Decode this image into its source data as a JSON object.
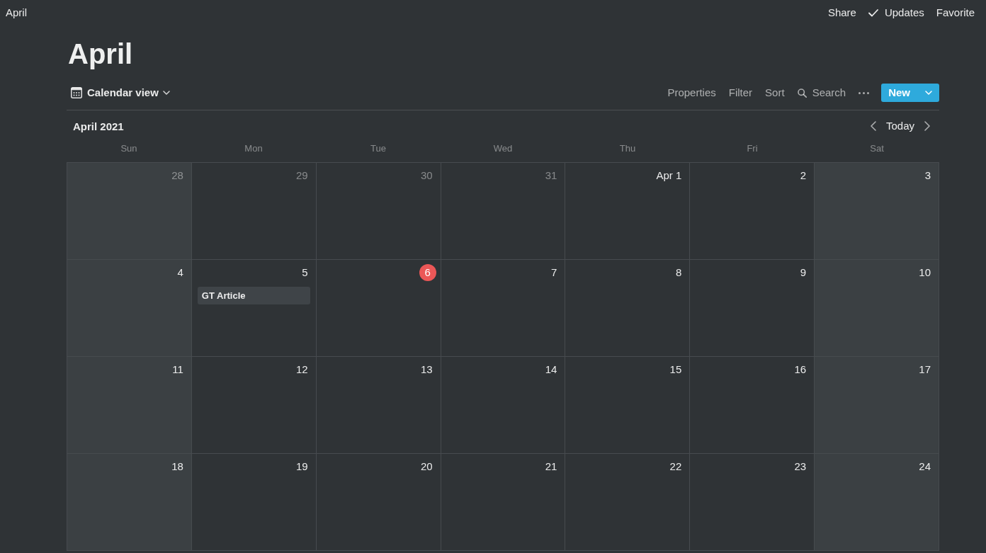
{
  "topbar": {
    "breadcrumb": "April",
    "actions": [
      {
        "label": "Share",
        "kind": "text"
      },
      {
        "label": "Updates",
        "kind": "check"
      },
      {
        "label": "Favorite",
        "kind": "text"
      }
    ]
  },
  "page": {
    "title": "April"
  },
  "toolbar": {
    "view": {
      "label": "Calendar view"
    },
    "actions": [
      {
        "label": "Properties",
        "kind": "text"
      },
      {
        "label": "Filter",
        "kind": "text"
      },
      {
        "label": "Sort",
        "kind": "text"
      },
      {
        "label": "Search",
        "kind": "search"
      }
    ],
    "new_button": {
      "label": "New"
    }
  },
  "calendar": {
    "month_label": "April 2021",
    "today_button": "Today",
    "weekdays": [
      {
        "label": "Sun",
        "weekend": true
      },
      {
        "label": "Mon",
        "weekend": false
      },
      {
        "label": "Tue",
        "weekend": false
      },
      {
        "label": "Wed",
        "weekend": false
      },
      {
        "label": "Thu",
        "weekend": false
      },
      {
        "label": "Fri",
        "weekend": false
      },
      {
        "label": "Sat",
        "weekend": true
      }
    ],
    "weeks": [
      {
        "days": [
          {
            "day": "28",
            "in_month": false,
            "today": false
          },
          {
            "day": "29",
            "in_month": false,
            "today": false
          },
          {
            "day": "30",
            "in_month": false,
            "today": false
          },
          {
            "day": "31",
            "in_month": false,
            "today": false
          },
          {
            "day": "Apr 1",
            "in_month": true,
            "today": false
          },
          {
            "day": "2",
            "in_month": true,
            "today": false
          },
          {
            "day": "3",
            "in_month": true,
            "today": false
          }
        ]
      },
      {
        "days": [
          {
            "day": "4",
            "in_month": true,
            "today": false
          },
          {
            "day": "5",
            "in_month": true,
            "today": false,
            "events": [
              {
                "title": "GT Article"
              }
            ]
          },
          {
            "day": "6",
            "in_month": true,
            "today": true
          },
          {
            "day": "7",
            "in_month": true,
            "today": false
          },
          {
            "day": "8",
            "in_month": true,
            "today": false
          },
          {
            "day": "9",
            "in_month": true,
            "today": false
          },
          {
            "day": "10",
            "in_month": true,
            "today": false
          }
        ]
      },
      {
        "days": [
          {
            "day": "11",
            "in_month": true,
            "today": false
          },
          {
            "day": "12",
            "in_month": true,
            "today": false
          },
          {
            "day": "13",
            "in_month": true,
            "today": false
          },
          {
            "day": "14",
            "in_month": true,
            "today": false
          },
          {
            "day": "15",
            "in_month": true,
            "today": false
          },
          {
            "day": "16",
            "in_month": true,
            "today": false
          },
          {
            "day": "17",
            "in_month": true,
            "today": false
          }
        ]
      },
      {
        "days": [
          {
            "day": "18",
            "in_month": true,
            "today": false
          },
          {
            "day": "19",
            "in_month": true,
            "today": false
          },
          {
            "day": "20",
            "in_month": true,
            "today": false
          },
          {
            "day": "21",
            "in_month": true,
            "today": false
          },
          {
            "day": "22",
            "in_month": true,
            "today": false
          },
          {
            "day": "23",
            "in_month": true,
            "today": false
          },
          {
            "day": "24",
            "in_month": true,
            "today": false
          }
        ]
      }
    ]
  }
}
